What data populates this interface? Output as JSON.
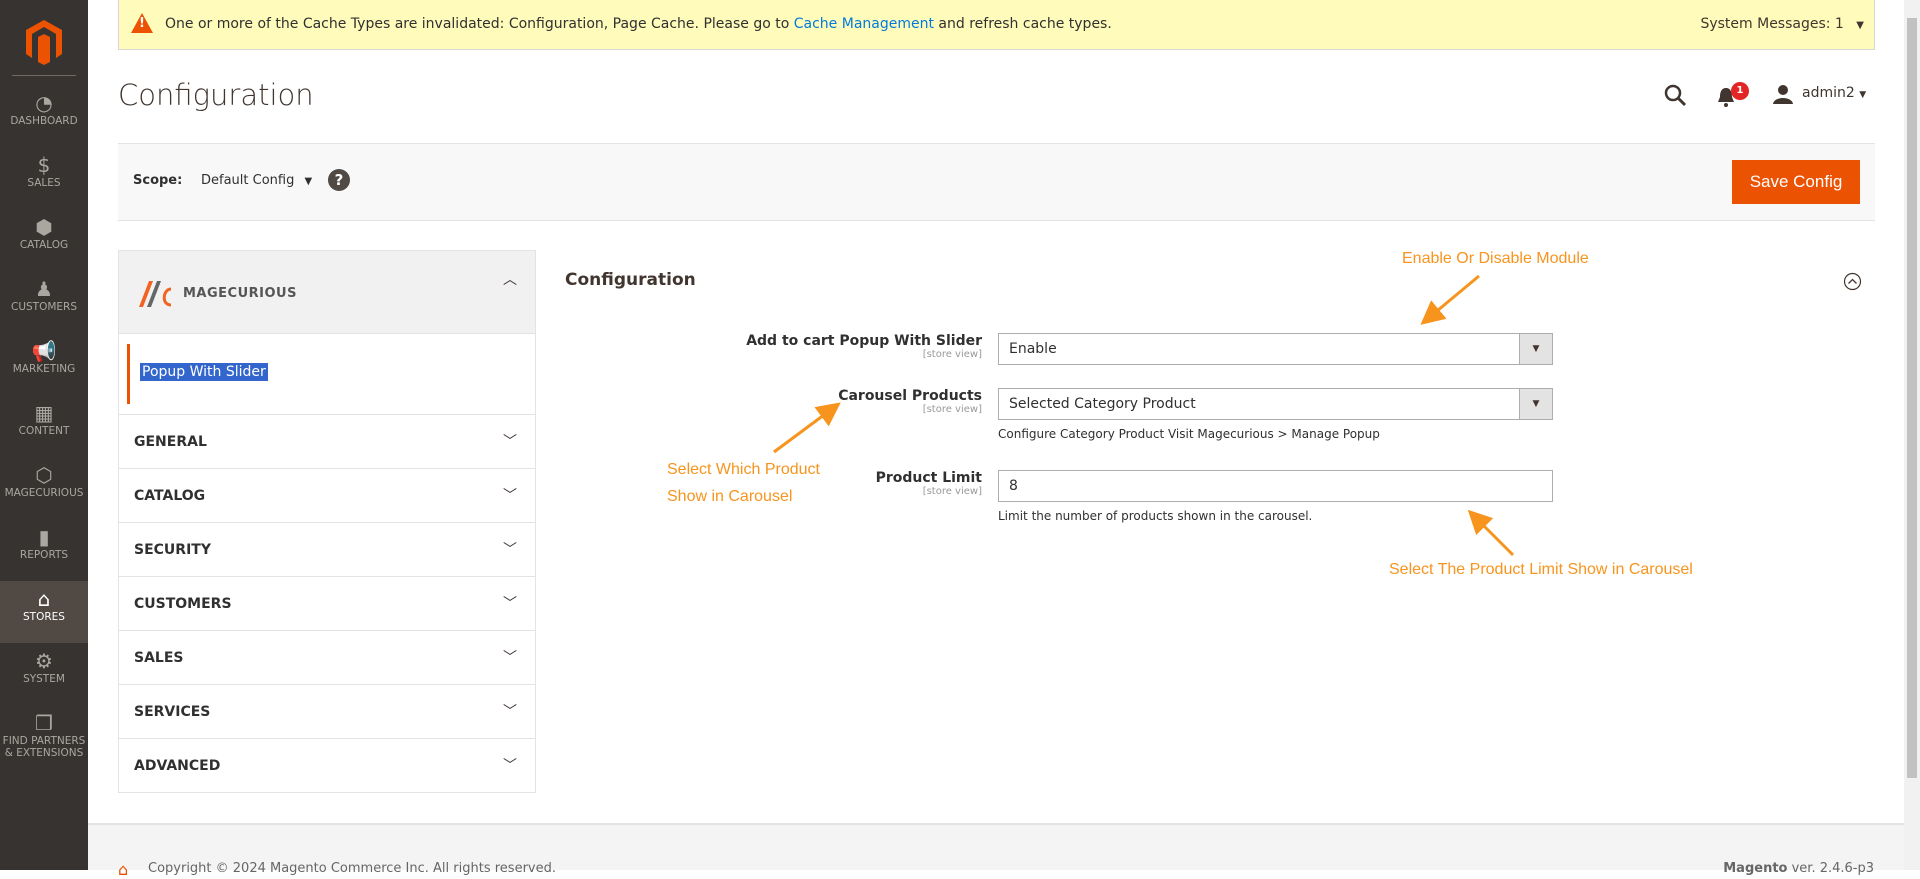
{
  "sidebar": {
    "items": [
      {
        "label": "DASHBOARD",
        "icon": "dashboard-icon"
      },
      {
        "label": "SALES",
        "icon": "dollar-icon"
      },
      {
        "label": "CATALOG",
        "icon": "box-icon"
      },
      {
        "label": "CUSTOMERS",
        "icon": "person-icon"
      },
      {
        "label": "MARKETING",
        "icon": "megaphone-icon"
      },
      {
        "label": "CONTENT",
        "icon": "layout-icon"
      },
      {
        "label": "MAGECURIOUS",
        "icon": "hexagon-icon"
      },
      {
        "label": "REPORTS",
        "icon": "bar-chart-icon"
      },
      {
        "label": "STORES",
        "icon": "store-icon",
        "active": true
      },
      {
        "label": "SYSTEM",
        "icon": "gear-icon"
      },
      {
        "label": "FIND PARTNERS",
        "label2": "& EXTENSIONS",
        "icon": "cubes-icon"
      }
    ]
  },
  "message": {
    "text": "One or more of the Cache Types are invalidated: Configuration, Page Cache. Please go to ",
    "link": "Cache Management",
    "after": " and refresh cache types.",
    "system_messages": "System Messages: 1"
  },
  "header": {
    "title": "Configuration",
    "notifications": "1",
    "user": "admin2"
  },
  "scope": {
    "label": "Scope:",
    "value": "Default Config",
    "save": "Save Config"
  },
  "leftnav": {
    "brand": "MAGECURIOUS",
    "active_item": "Popup With Slider",
    "sections": [
      "GENERAL",
      "CATALOG",
      "SECURITY",
      "CUSTOMERS",
      "SALES",
      "SERVICES",
      "ADVANCED"
    ]
  },
  "main": {
    "section_title": "Configuration",
    "fields": [
      {
        "label": "Add to cart Popup With Slider",
        "scope": "[store view]",
        "value": "Enable",
        "note": ""
      },
      {
        "label": "Carousel Products",
        "scope": "[store view]",
        "value": "Selected Category Product",
        "note": "Configure Category Product Visit Magecurious > Manage Popup"
      },
      {
        "label": "Product Limit",
        "scope": "[store view]",
        "value": "8",
        "note": "Limit the number of products shown in the carousel."
      }
    ]
  },
  "annotations": {
    "enable": "Enable Or Disable Module",
    "which1": "Select Which Product",
    "which2": "Show in Carousel",
    "limit": "Select The Product Limit Show in Carousel",
    "color": "#f7941d"
  },
  "footer": {
    "copyright": "Copyright © 2024 Magento Commerce Inc. All rights reserved.",
    "brand": "Magento",
    "version": " ver. 2.4.6-p3"
  }
}
